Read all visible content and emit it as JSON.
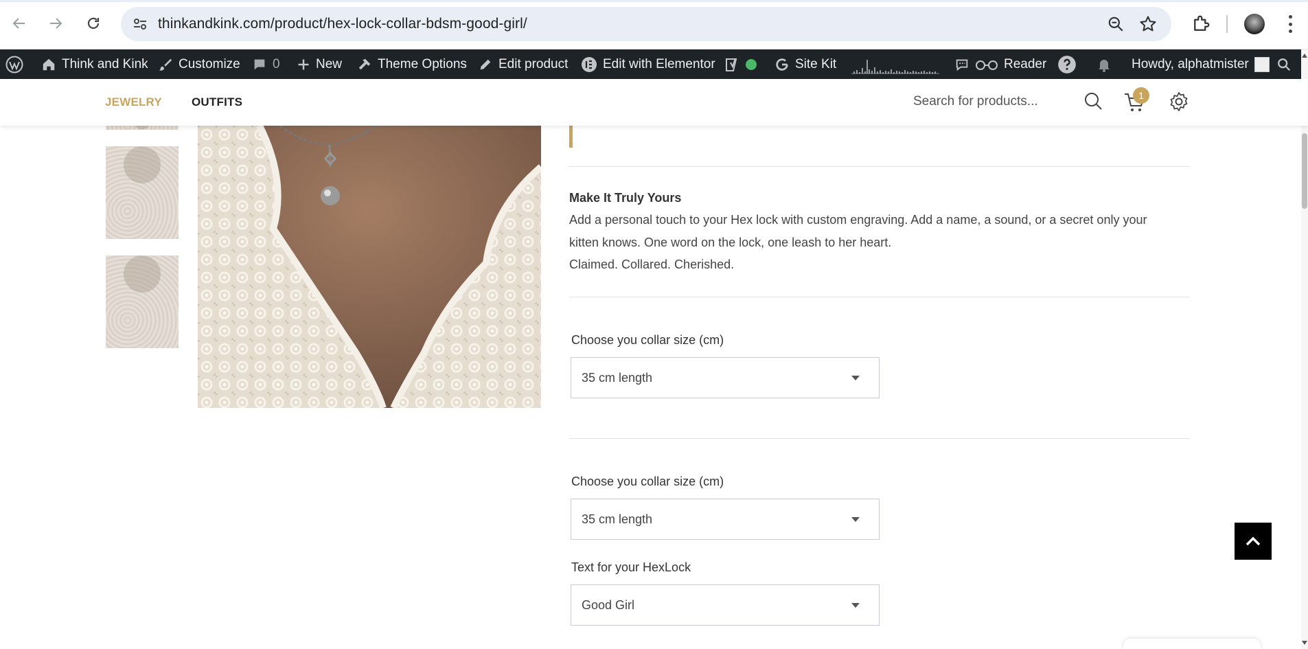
{
  "browser": {
    "url": "thinkandkink.com/product/hex-lock-collar-bdsm-good-girl/"
  },
  "adminbar": {
    "site_name": "Think and Kink",
    "customize": "Customize",
    "comments_count": "0",
    "new": "New",
    "theme_options": "Theme Options",
    "edit_product": "Edit product",
    "edit_elementor": "Edit with Elementor",
    "site_kit": "Site Kit",
    "reader": "Reader",
    "howdy": "Howdy, alphatmister"
  },
  "header": {
    "menu": [
      {
        "label": "JEWELRY",
        "active": true
      },
      {
        "label": "OUTFITS",
        "active": false
      }
    ],
    "search_placeholder": "Search for products...",
    "cart_count": "1"
  },
  "product": {
    "section_title": "Make It Truly Yours",
    "description_lines": [
      "Add a personal touch to your Hex lock with custom engraving. Add a name, a sound, or a secret only your",
      "kitten knows. One word on the lock, one leash to her heart.",
      "Claimed. Collared. Cherished."
    ],
    "fields": [
      {
        "label": "Choose you collar size (cm)",
        "value": "35 cm length"
      },
      {
        "label": "Choose you collar size (cm)",
        "value": "35 cm length"
      },
      {
        "label": "Text for your HexLock",
        "value": "Good Girl"
      }
    ]
  },
  "colors": {
    "accent": "#c9a45c",
    "adminbar_bg": "#1d2327"
  }
}
